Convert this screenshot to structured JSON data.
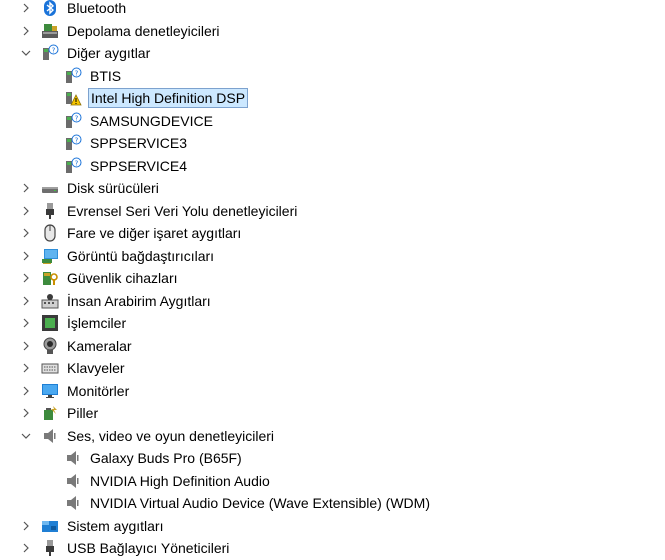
{
  "tree": {
    "items": [
      {
        "label": "Bluetooth",
        "level": 0,
        "expanded": false,
        "icon": "bluetooth-icon"
      },
      {
        "label": "Depolama denetleyicileri",
        "level": 0,
        "expanded": false,
        "icon": "storage-controller-icon"
      },
      {
        "label": "Diğer aygıtlar",
        "level": 0,
        "expanded": true,
        "icon": "unknown-device-icon"
      },
      {
        "label": "BTIS",
        "level": 1,
        "icon": "unknown-device-icon"
      },
      {
        "label": "Intel High Definition DSP",
        "level": 1,
        "icon": "warning-device-icon",
        "selected": true
      },
      {
        "label": "SAMSUNGDEVICE",
        "level": 1,
        "icon": "unknown-device-icon"
      },
      {
        "label": "SPPSERVICE3",
        "level": 1,
        "icon": "unknown-device-icon"
      },
      {
        "label": "SPPSERVICE4",
        "level": 1,
        "icon": "unknown-device-icon"
      },
      {
        "label": "Disk sürücüleri",
        "level": 0,
        "expanded": false,
        "icon": "disk-drive-icon"
      },
      {
        "label": "Evrensel Seri Veri Yolu denetleyicileri",
        "level": 0,
        "expanded": false,
        "icon": "usb-icon"
      },
      {
        "label": "Fare ve diğer işaret aygıtları",
        "level": 0,
        "expanded": false,
        "icon": "mouse-icon"
      },
      {
        "label": "Görüntü bağdaştırıcıları",
        "level": 0,
        "expanded": false,
        "icon": "display-adapter-icon"
      },
      {
        "label": "Güvenlik cihazları",
        "level": 0,
        "expanded": false,
        "icon": "security-device-icon"
      },
      {
        "label": "İnsan Arabirim Aygıtları",
        "level": 0,
        "expanded": false,
        "icon": "hid-icon"
      },
      {
        "label": "İşlemciler",
        "level": 0,
        "expanded": false,
        "icon": "processor-icon"
      },
      {
        "label": "Kameralar",
        "level": 0,
        "expanded": false,
        "icon": "camera-icon"
      },
      {
        "label": "Klavyeler",
        "level": 0,
        "expanded": false,
        "icon": "keyboard-icon"
      },
      {
        "label": "Monitörler",
        "level": 0,
        "expanded": false,
        "icon": "monitor-icon"
      },
      {
        "label": "Piller",
        "level": 0,
        "expanded": false,
        "icon": "battery-icon"
      },
      {
        "label": "Ses, video ve oyun denetleyicileri",
        "level": 0,
        "expanded": true,
        "icon": "speaker-icon"
      },
      {
        "label": "Galaxy Buds Pro (B65F)",
        "level": 1,
        "icon": "speaker-icon"
      },
      {
        "label": "NVIDIA High Definition Audio",
        "level": 1,
        "icon": "speaker-icon"
      },
      {
        "label": "NVIDIA Virtual Audio Device (Wave Extensible) (WDM)",
        "level": 1,
        "icon": "speaker-icon"
      },
      {
        "label": "Sistem aygıtları",
        "level": 0,
        "expanded": false,
        "icon": "system-device-icon"
      },
      {
        "label": "USB Bağlayıcı Yöneticileri",
        "level": 0,
        "expanded": false,
        "icon": "usb-connector-icon"
      }
    ]
  },
  "colors": {
    "selection_bg": "#cce8ff",
    "selection_border": "#7da2ce",
    "bluetooth": "#1a73d9",
    "warning": "#f5c400"
  }
}
